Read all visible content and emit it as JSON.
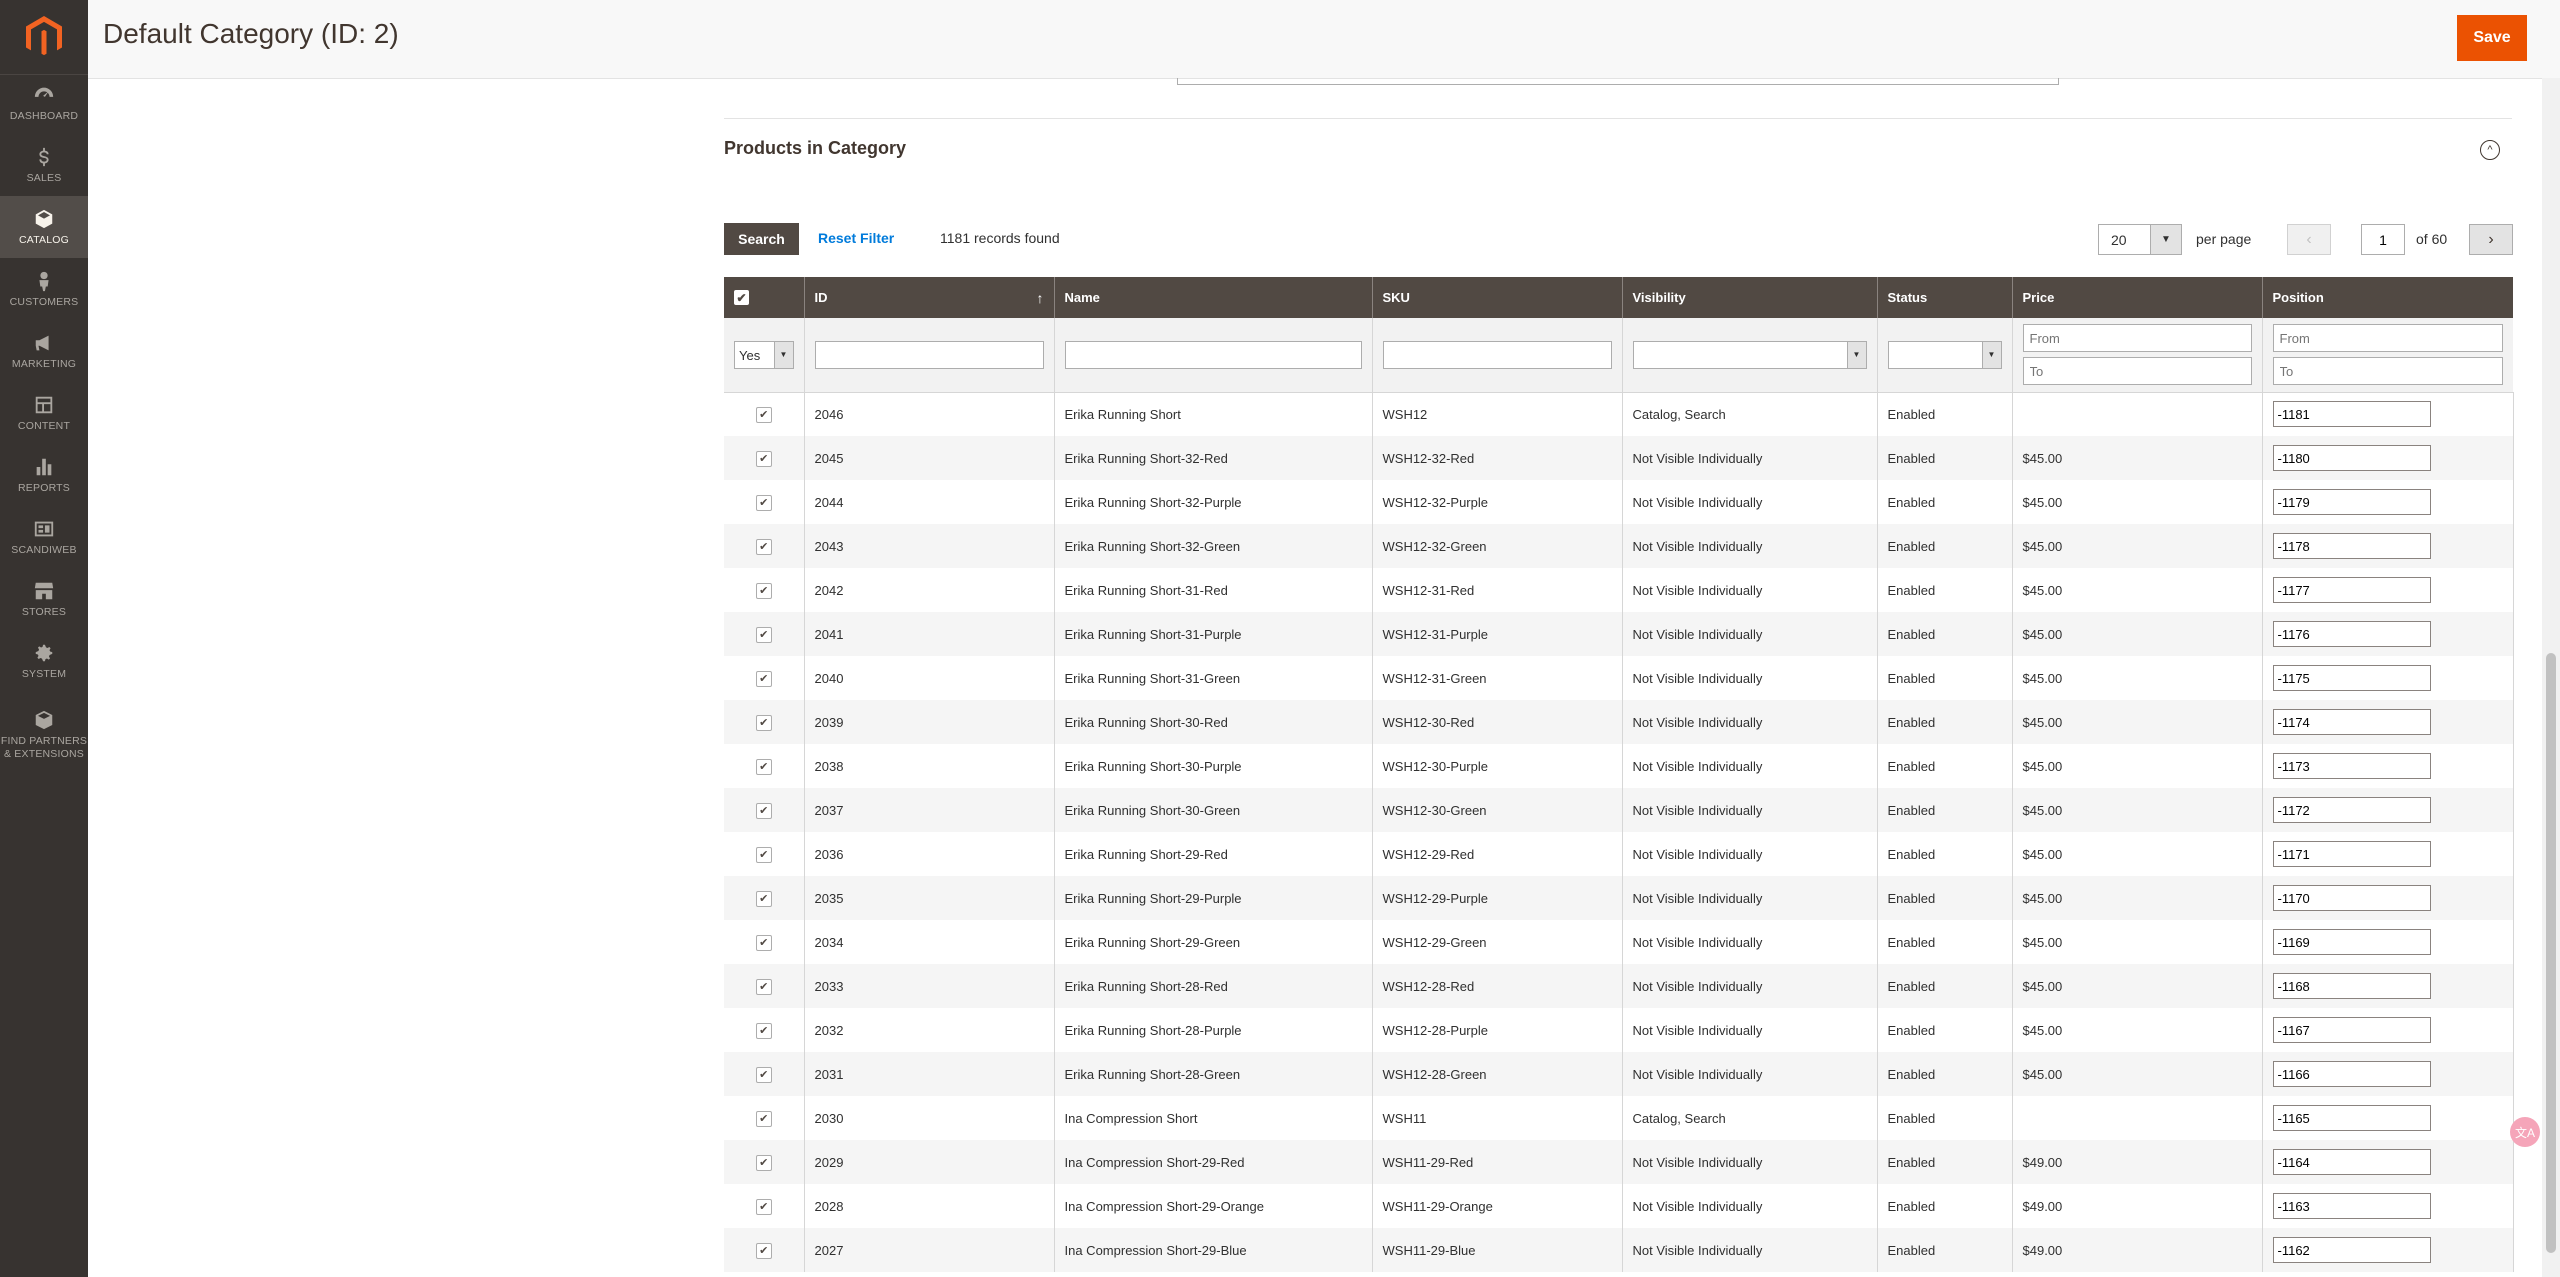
{
  "sidebar": {
    "items": [
      {
        "label": "DASHBOARD",
        "icon": "speedometer-icon"
      },
      {
        "label": "SALES",
        "icon": "dollar-icon"
      },
      {
        "label": "CATALOG",
        "icon": "cube-icon"
      },
      {
        "label": "CUSTOMERS",
        "icon": "person-icon"
      },
      {
        "label": "MARKETING",
        "icon": "megaphone-icon"
      },
      {
        "label": "CONTENT",
        "icon": "layout-icon"
      },
      {
        "label": "REPORTS",
        "icon": "bar-chart-icon"
      },
      {
        "label": "SCANDIWEB",
        "icon": "scandiweb-icon"
      },
      {
        "label": "STORES",
        "icon": "storefront-icon"
      },
      {
        "label": "SYSTEM",
        "icon": "gear-icon"
      },
      {
        "label": "FIND PARTNERS & EXTENSIONS",
        "icon": "box-icon"
      }
    ],
    "active": "CATALOG"
  },
  "header": {
    "title": "Default Category (ID: 2)",
    "save_label": "Save"
  },
  "section": {
    "title": "Products in Category"
  },
  "toolbar": {
    "search_label": "Search",
    "reset_label": "Reset Filter",
    "records": "1181 records found",
    "per_page_value": "20",
    "per_page_label": "per page",
    "page": "1",
    "page_of": "of 60"
  },
  "grid": {
    "columns": [
      "ID",
      "Name",
      "SKU",
      "Visibility",
      "Status",
      "Price",
      "Position"
    ],
    "filters": {
      "in_category": "Yes",
      "from_placeholder": "From",
      "to_placeholder": "To"
    },
    "rows": [
      {
        "id": "2046",
        "name": "Erika Running Short",
        "sku": "WSH12",
        "visibility": "Catalog, Search",
        "status": "Enabled",
        "price": "",
        "position": "-1181"
      },
      {
        "id": "2045",
        "name": "Erika Running Short-32-Red",
        "sku": "WSH12-32-Red",
        "visibility": "Not Visible Individually",
        "status": "Enabled",
        "price": "$45.00",
        "position": "-1180"
      },
      {
        "id": "2044",
        "name": "Erika Running Short-32-Purple",
        "sku": "WSH12-32-Purple",
        "visibility": "Not Visible Individually",
        "status": "Enabled",
        "price": "$45.00",
        "position": "-1179"
      },
      {
        "id": "2043",
        "name": "Erika Running Short-32-Green",
        "sku": "WSH12-32-Green",
        "visibility": "Not Visible Individually",
        "status": "Enabled",
        "price": "$45.00",
        "position": "-1178"
      },
      {
        "id": "2042",
        "name": "Erika Running Short-31-Red",
        "sku": "WSH12-31-Red",
        "visibility": "Not Visible Individually",
        "status": "Enabled",
        "price": "$45.00",
        "position": "-1177"
      },
      {
        "id": "2041",
        "name": "Erika Running Short-31-Purple",
        "sku": "WSH12-31-Purple",
        "visibility": "Not Visible Individually",
        "status": "Enabled",
        "price": "$45.00",
        "position": "-1176"
      },
      {
        "id": "2040",
        "name": "Erika Running Short-31-Green",
        "sku": "WSH12-31-Green",
        "visibility": "Not Visible Individually",
        "status": "Enabled",
        "price": "$45.00",
        "position": "-1175"
      },
      {
        "id": "2039",
        "name": "Erika Running Short-30-Red",
        "sku": "WSH12-30-Red",
        "visibility": "Not Visible Individually",
        "status": "Enabled",
        "price": "$45.00",
        "position": "-1174"
      },
      {
        "id": "2038",
        "name": "Erika Running Short-30-Purple",
        "sku": "WSH12-30-Purple",
        "visibility": "Not Visible Individually",
        "status": "Enabled",
        "price": "$45.00",
        "position": "-1173"
      },
      {
        "id": "2037",
        "name": "Erika Running Short-30-Green",
        "sku": "WSH12-30-Green",
        "visibility": "Not Visible Individually",
        "status": "Enabled",
        "price": "$45.00",
        "position": "-1172"
      },
      {
        "id": "2036",
        "name": "Erika Running Short-29-Red",
        "sku": "WSH12-29-Red",
        "visibility": "Not Visible Individually",
        "status": "Enabled",
        "price": "$45.00",
        "position": "-1171"
      },
      {
        "id": "2035",
        "name": "Erika Running Short-29-Purple",
        "sku": "WSH12-29-Purple",
        "visibility": "Not Visible Individually",
        "status": "Enabled",
        "price": "$45.00",
        "position": "-1170"
      },
      {
        "id": "2034",
        "name": "Erika Running Short-29-Green",
        "sku": "WSH12-29-Green",
        "visibility": "Not Visible Individually",
        "status": "Enabled",
        "price": "$45.00",
        "position": "-1169"
      },
      {
        "id": "2033",
        "name": "Erika Running Short-28-Red",
        "sku": "WSH12-28-Red",
        "visibility": "Not Visible Individually",
        "status": "Enabled",
        "price": "$45.00",
        "position": "-1168"
      },
      {
        "id": "2032",
        "name": "Erika Running Short-28-Purple",
        "sku": "WSH12-28-Purple",
        "visibility": "Not Visible Individually",
        "status": "Enabled",
        "price": "$45.00",
        "position": "-1167"
      },
      {
        "id": "2031",
        "name": "Erika Running Short-28-Green",
        "sku": "WSH12-28-Green",
        "visibility": "Not Visible Individually",
        "status": "Enabled",
        "price": "$45.00",
        "position": "-1166"
      },
      {
        "id": "2030",
        "name": "Ina Compression Short",
        "sku": "WSH11",
        "visibility": "Catalog, Search",
        "status": "Enabled",
        "price": "",
        "position": "-1165"
      },
      {
        "id": "2029",
        "name": "Ina Compression Short-29-Red",
        "sku": "WSH11-29-Red",
        "visibility": "Not Visible Individually",
        "status": "Enabled",
        "price": "$49.00",
        "position": "-1164"
      },
      {
        "id": "2028",
        "name": "Ina Compression Short-29-Orange",
        "sku": "WSH11-29-Orange",
        "visibility": "Not Visible Individually",
        "status": "Enabled",
        "price": "$49.00",
        "position": "-1163"
      },
      {
        "id": "2027",
        "name": "Ina Compression Short-29-Blue",
        "sku": "WSH11-29-Blue",
        "visibility": "Not Visible Individually",
        "status": "Enabled",
        "price": "$49.00",
        "position": "-1162"
      }
    ]
  },
  "colors": {
    "accent": "#eb5202",
    "sidebar": "#373330",
    "grid_header": "#514943",
    "link": "#007bdb"
  }
}
